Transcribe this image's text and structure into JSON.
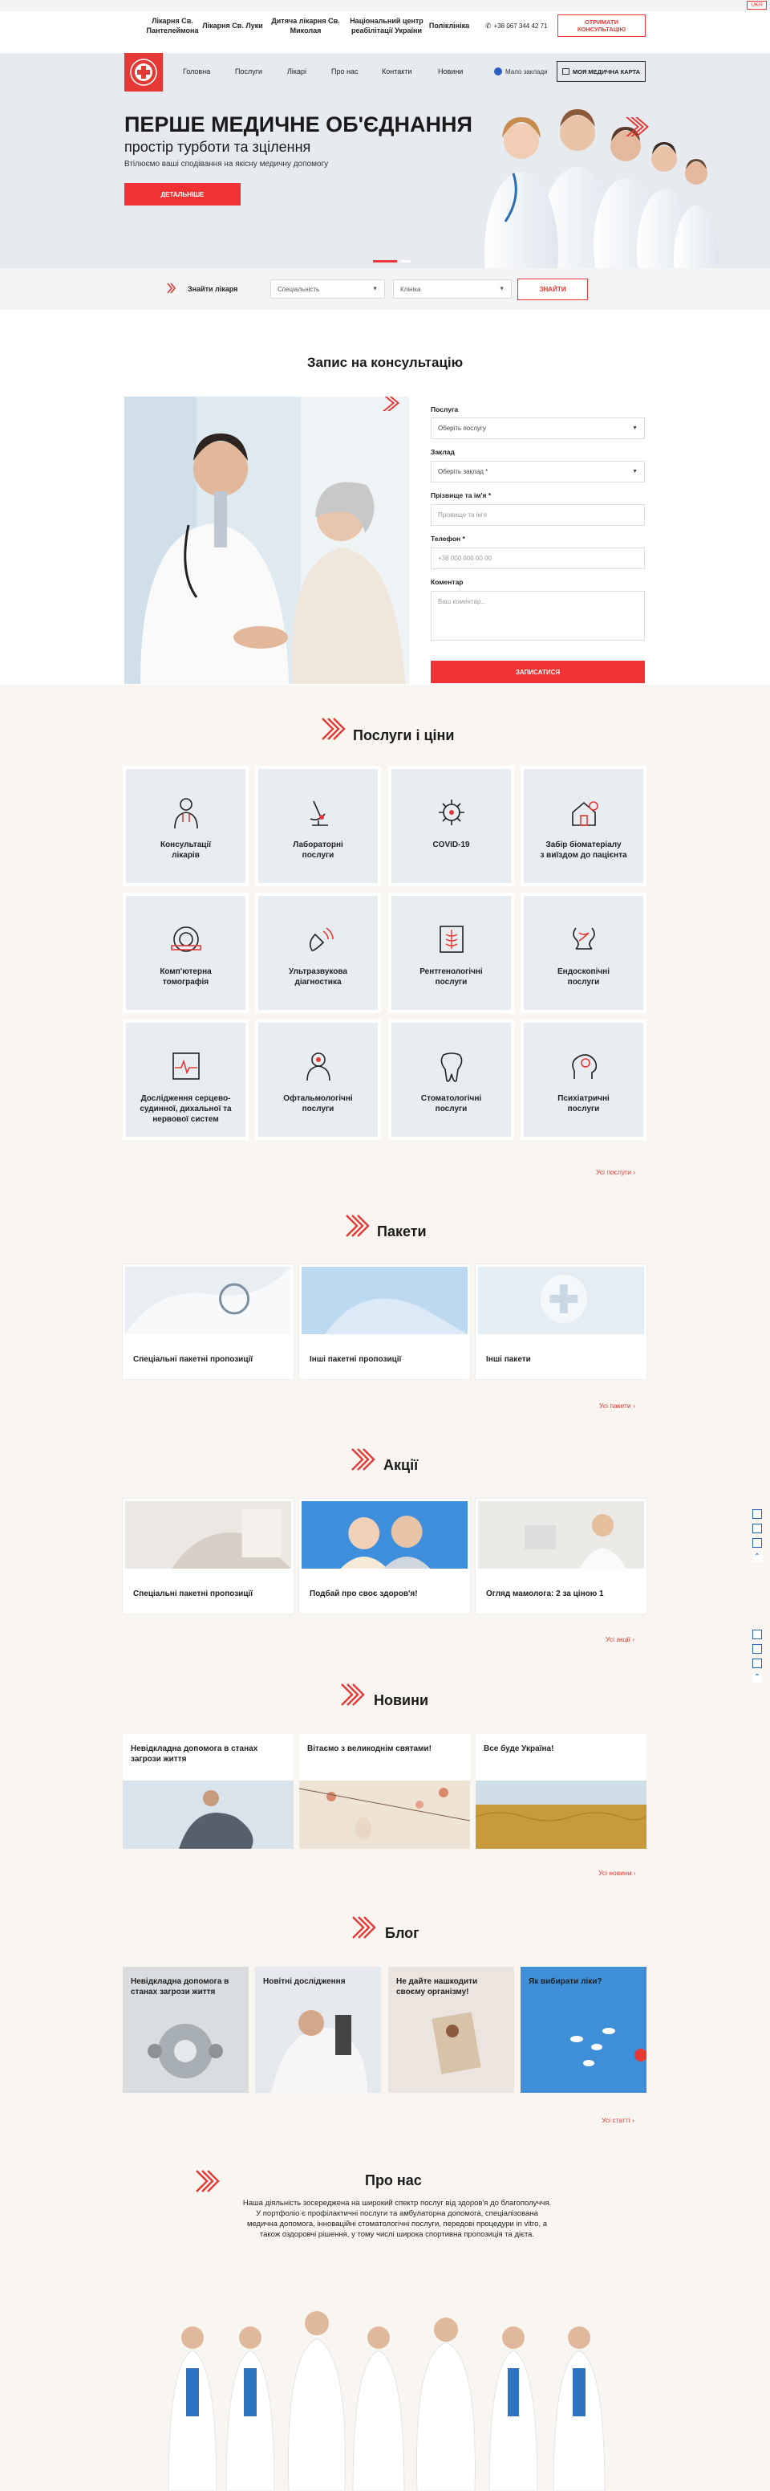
{
  "lang": "UKR",
  "topnav": {
    "items": [
      "Лікарня Св.\nПантелеймона",
      "Лікарня Св. Луки",
      "Дитяча лікарня Св.\nМиколая",
      "Національний центр\nреабілітації України",
      "Поліклініка"
    ],
    "phone": "+38 067 344 42 71",
    "consult_button": "ОТРИМАТИ\nКОНСУЛЬТАЦІЮ"
  },
  "mainnav": {
    "items": [
      "Головна",
      "Послуги",
      "Лікарі",
      "Про нас",
      "Контакти",
      "Новини"
    ],
    "eye_link": "Мало заклади",
    "card_button": "МОЯ МЕДИЧНА КАРТА"
  },
  "hero": {
    "title": "ПЕРШЕ МЕДИЧНЕ ОБ'ЄДНАННЯ",
    "subtitle": "простір турботи та зцілення",
    "description": "Втілюємо ваші сподівання на якісну медичну допомогу",
    "button": "ДЕТАЛЬНІШЕ"
  },
  "search": {
    "label": "Знайти лікаря",
    "specialty": "Спеціальність",
    "clinic": "Клініка",
    "button": "ЗНАЙТИ"
  },
  "booking": {
    "title": "Запис на консультацію",
    "service_label": "Послуга",
    "service_value": "Оберіть послугу",
    "place_label": "Заклад",
    "place_value": "Оберіть заклад *",
    "name_label": "Прізвище та ім'я *",
    "name_placeholder": "Прізвище та ім'я",
    "phone_label": "Телефон *",
    "phone_placeholder": "+38 000 000 00 00",
    "comment_label": "Коментар",
    "comment_placeholder": "Ваш коментар...",
    "submit": "ЗАПИСАТИСЯ"
  },
  "services": {
    "title": "Послуги і ціни",
    "items": [
      {
        "label": "Консультації\nлікарів",
        "icon": "doctor-icon"
      },
      {
        "label": "Лабораторні\nпослуги",
        "icon": "microscope-icon"
      },
      {
        "label": "COVID-19",
        "icon": "virus-icon"
      },
      {
        "label": "Забір біоматеріалу\nз виїздом до пацієнта",
        "icon": "home-visit-icon"
      },
      {
        "label": "Комп'ютерна\nтомографія",
        "icon": "ct-scanner-icon"
      },
      {
        "label": "Ультразвукова\nдіагностика",
        "icon": "ultrasound-icon"
      },
      {
        "label": "Рентгенологічні\nпослуги",
        "icon": "xray-icon"
      },
      {
        "label": "Ендоскопічні\nпослуги",
        "icon": "intestine-icon"
      },
      {
        "label": "Дослідження серцево-\nсудинної, дихальної та\nнервової систем",
        "icon": "cardiogram-icon"
      },
      {
        "label": "Офтальмологічні\nпослуги",
        "icon": "ophthalmologist-icon"
      },
      {
        "label": "Стоматологічні\nпослуги",
        "icon": "tooth-icon"
      },
      {
        "label": "Психіатричні\nпослуги",
        "icon": "psychiatry-icon"
      }
    ],
    "more": "Усі послуги"
  },
  "packages": {
    "title": "Пакети",
    "items": [
      "Спеціальні пакетні пропозиції",
      "Інші пакетні пропозиції",
      "Інші пакети"
    ],
    "more": "Усі пакети"
  },
  "promos": {
    "title": "Акції",
    "items": [
      "Спеціальні пакетні пропозиції",
      "Подбай про своє здоров'я!",
      "Огляд мамолога: 2 за ціною 1"
    ],
    "more": "Усі акції"
  },
  "news": {
    "title": "Новини",
    "items": [
      "Невідкладна допомога в станах\nзагрози життя",
      "Вітаємо з великоднім святами!",
      "Все буде Україна!"
    ],
    "more": "Усі новини"
  },
  "blog": {
    "title": "Блог",
    "items": [
      "Невідкладна допомога в\nстанах загрози життя",
      "Новітні дослідження",
      "Не дайте нашкодити\nсвоєму організму!",
      "Як вибирати ліки?"
    ],
    "more": "Усі статті"
  },
  "about": {
    "title": "Про нас",
    "text": "Наша діяльність зосереджена на широкий спектр послуг від здоров'я до благополуччя. У портфоліо є профілактичні послуги та амбулаторна допомога, спеціалізована медична допомога, інноваційні стоматологічні послуги, передові процедури in vitro, а також оздоровчі рішення, у тому числі широка спортивна пропозиція та дієта."
  },
  "colors": {
    "accent": "#e53935",
    "hero_bg": "#e7ebf0",
    "tile_bg": "#e8edf2",
    "beige": "#f9f6f2"
  }
}
